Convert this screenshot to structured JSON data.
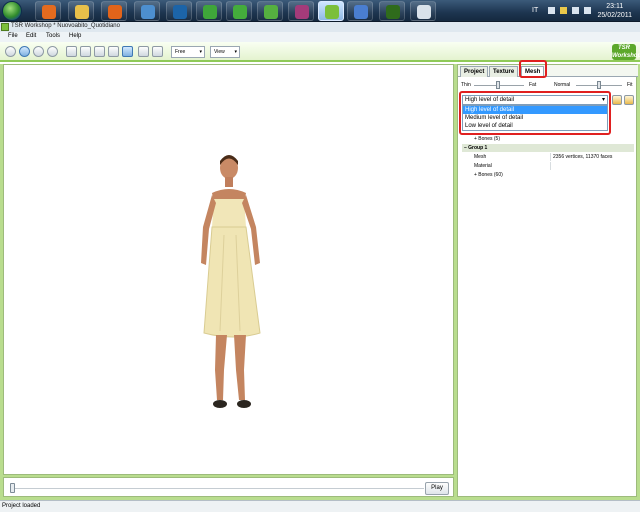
{
  "taskbar": {
    "language": "IT",
    "time": "23:11",
    "date": "25/02/2011",
    "apps": [
      {
        "name": "media-player-icon",
        "color": "#e46b1f"
      },
      {
        "name": "folder-icon",
        "color": "#e8c04a"
      },
      {
        "name": "firefox-icon",
        "color": "#e2641a"
      },
      {
        "name": "network-icon",
        "color": "#4d8fcf"
      },
      {
        "name": "photoshop-icon",
        "color": "#1c64a8"
      },
      {
        "name": "sims-icon",
        "color": "#3fa63a"
      },
      {
        "name": "sims-icon",
        "color": "#44ac3c"
      },
      {
        "name": "sims-icon",
        "color": "#55b040"
      },
      {
        "name": "sims-icon",
        "color": "#a43b7a"
      },
      {
        "name": "tsr-workshop-icon",
        "color": "#7bbf3b"
      },
      {
        "name": "browser-icon",
        "color": "#4a7ed0"
      },
      {
        "name": "w-app-icon",
        "color": "#2f6b1c"
      },
      {
        "name": "paint-icon",
        "color": "#d9e2ea"
      }
    ]
  },
  "window": {
    "title": "TSR Workshop * Nuovoabito_Quotidiano"
  },
  "menu": [
    "File",
    "Edit",
    "Tools",
    "Help"
  ],
  "toolbar": {
    "camera_mode": "Free",
    "view_menu": "View",
    "logo": "TSR Workshop"
  },
  "panel": {
    "tabs": [
      "Project",
      "Texture",
      "Mesh"
    ],
    "active_tab": "Mesh",
    "sliders": {
      "thin": "Thin",
      "fat": "Fat",
      "normal": "Normal",
      "fit": "Fit"
    },
    "lod": {
      "selected": "High level of detail",
      "options": [
        "High level of detail",
        "Medium level of detail",
        "Low level of detail"
      ]
    },
    "tree": [
      {
        "key": "+ Bones (5)",
        "value": "",
        "group": false,
        "indent": true
      },
      {
        "key": "– Group 1",
        "value": "",
        "group": true,
        "indent": false
      },
      {
        "key": "Mesh",
        "value": "2356 vertices, 11370 faces",
        "group": false,
        "indent": false
      },
      {
        "key": "Material",
        "value": "",
        "group": false,
        "indent": false
      },
      {
        "key": "+ Bones (60)",
        "value": "",
        "group": false,
        "indent": true
      }
    ]
  },
  "timeline": {
    "play_label": "Play"
  },
  "status": "Project loaded",
  "colors": {
    "accent_green": "#8fca57",
    "highlight_red": "#e02020",
    "selection_blue": "#3399ff"
  }
}
